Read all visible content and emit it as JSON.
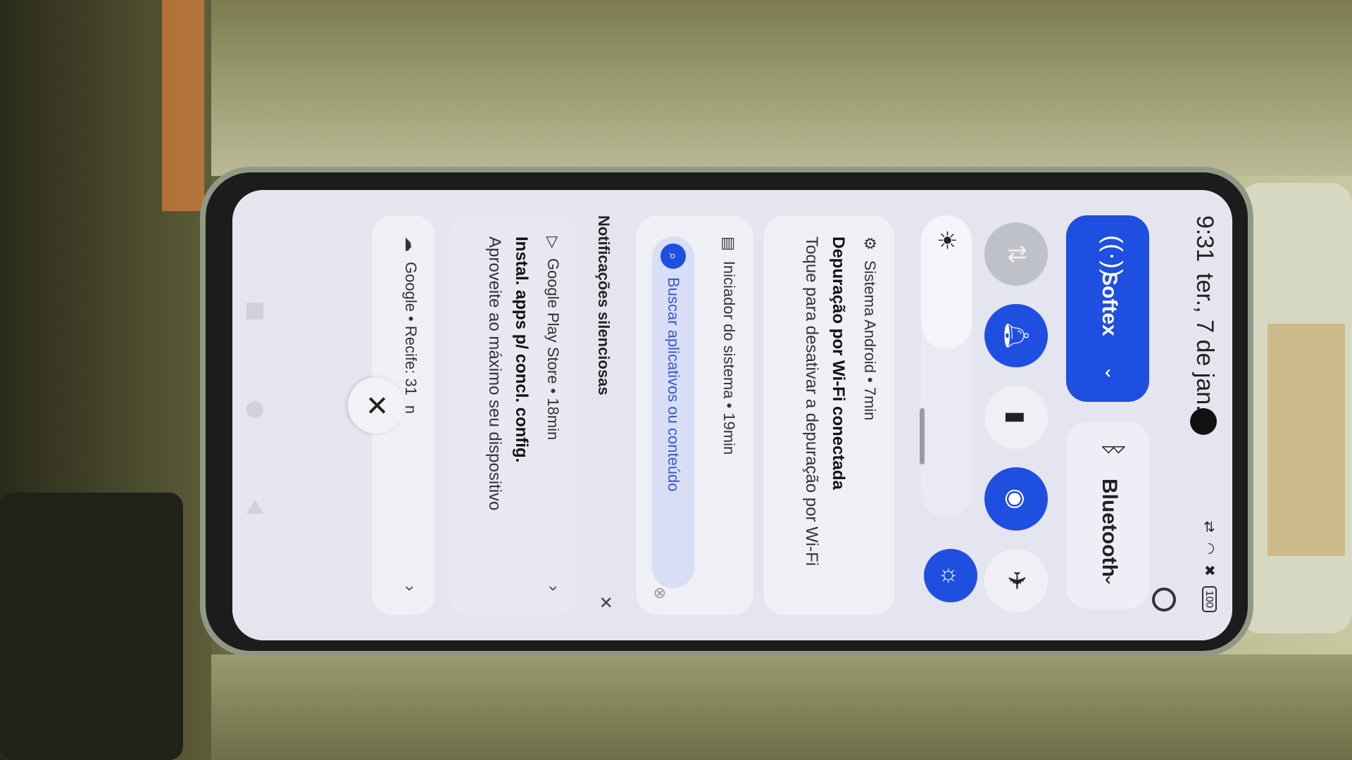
{
  "status_bar": {
    "time": "9:31",
    "date": "ter., 7 de jan.",
    "battery": "100"
  },
  "quick_settings": {
    "wifi": {
      "label": "Softex",
      "icon": "wifi-icon",
      "color": "#1f4fe0"
    },
    "bluetooth": {
      "label": "Bluetooth",
      "icon": "bluetooth-icon"
    },
    "toggles": [
      "data-transfer-icon",
      "ring-icon",
      "flashlight-icon",
      "location-icon",
      "airplane-icon",
      "auto-brightness-icon"
    ]
  },
  "notifications": [
    {
      "header": "Sistema Android • 7min",
      "title": "Depuração por Wi-Fi conectada",
      "body": "Toque para desativar a depuração por Wi-Fi"
    },
    {
      "header": "Iniciador do sistema • 19min",
      "search_label": "Buscar aplicativos ou conteúdo"
    },
    {
      "section": "Notificações silenciosas"
    },
    {
      "header": "Google Play Store • 18min",
      "title": "Instal. apps p/ concl. config.",
      "body": "Aproveite ao máximo seu dispositivo"
    },
    {
      "header": "Google • Recife: 31",
      "trail": "n"
    }
  ]
}
